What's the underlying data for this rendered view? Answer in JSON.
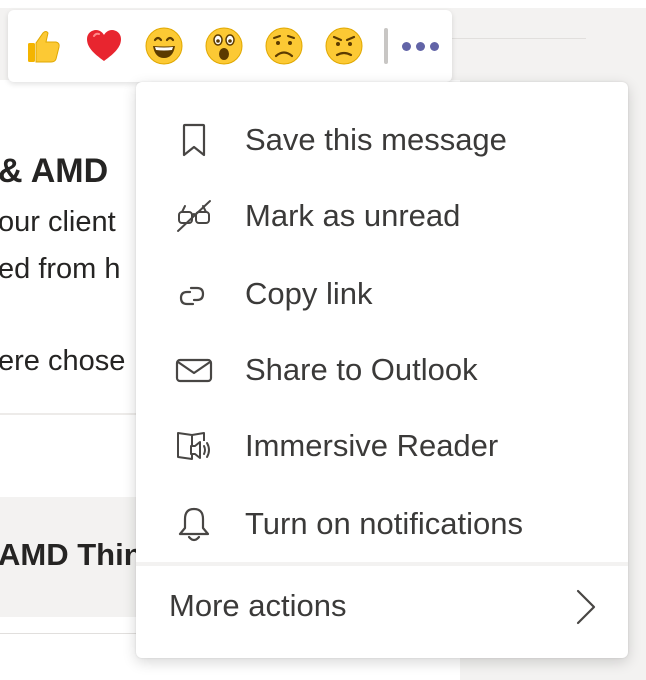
{
  "background": {
    "heading_fragment": "& AMD",
    "line1": "our client",
    "line2": "ed from h",
    "line3": "ere chose",
    "line4": "AMD Thin"
  },
  "reactions": [
    {
      "name": "like",
      "icon": "thumbs-up-icon"
    },
    {
      "name": "heart",
      "icon": "heart-icon"
    },
    {
      "name": "laugh",
      "icon": "laugh-icon"
    },
    {
      "name": "surprised",
      "icon": "surprised-icon"
    },
    {
      "name": "sad",
      "icon": "sad-icon"
    },
    {
      "name": "angry",
      "icon": "angry-icon"
    }
  ],
  "menu": {
    "items": [
      {
        "label": "Save this message",
        "icon": "bookmark-icon"
      },
      {
        "label": "Mark as unread",
        "icon": "mark-unread-icon"
      },
      {
        "label": "Copy link",
        "icon": "link-icon"
      },
      {
        "label": "Share to Outlook",
        "icon": "envelope-icon"
      },
      {
        "label": "Immersive Reader",
        "icon": "immersive-reader-icon"
      },
      {
        "label": "Turn on notifications",
        "icon": "bell-icon"
      }
    ],
    "more_actions": "More actions"
  },
  "colors": {
    "accent": "#6264a7",
    "heart": "#e8252f",
    "emoji_yellow": "#fcc934"
  }
}
